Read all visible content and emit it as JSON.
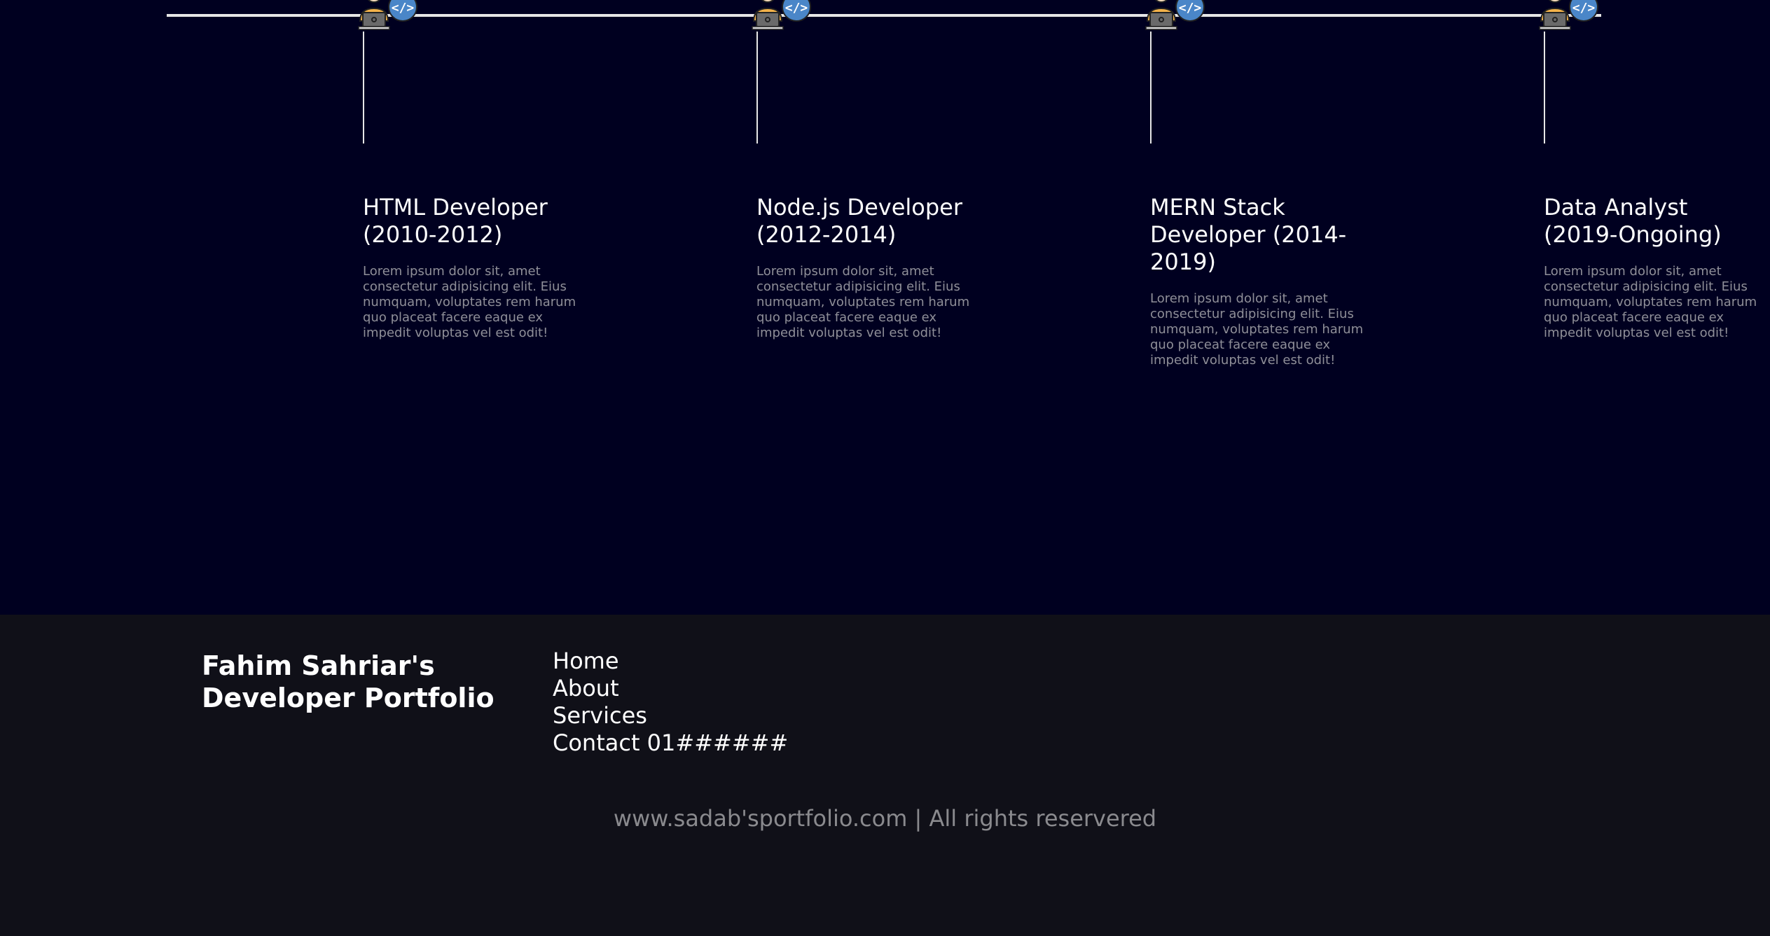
{
  "timeline": {
    "items": [
      {
        "title": "HTML Developer (2010-2012)",
        "description": "Lorem ipsum dolor sit, amet consectetur adipisicing elit. Eius numquam, voluptates rem harum quo placeat facere eaque ex impedit voluptas vel est odit!"
      },
      {
        "title": "Node.js Developer (2012-2014)",
        "description": "Lorem ipsum dolor sit, amet consectetur adipisicing elit. Eius numquam, voluptates rem harum quo placeat facere eaque ex impedit voluptas vel est odit!"
      },
      {
        "title": "MERN Stack Developer (2014-2019)",
        "description": "Lorem ipsum dolor sit, amet consectetur adipisicing elit. Eius numquam, voluptates rem harum quo placeat facere eaque ex impedit voluptas vel est odit!"
      },
      {
        "title": "Data Analyst (2019-Ongoing)",
        "description": "Lorem ipsum dolor sit, amet consectetur adipisicing elit. Eius numquam, voluptates rem harum quo placeat facere eaque ex impedit voluptas vel est odit!"
      }
    ],
    "icon": "developer-laptop-code-icon"
  },
  "footer": {
    "brand": "Fahim Sahriar's Developer Portfolio",
    "nav": [
      "Home",
      "About",
      "Services",
      "Contact 01######"
    ],
    "copyright": "www.sadab'sportfolio.com | All rights reservered"
  },
  "colors": {
    "timeline_bg": "#000020",
    "footer_bg": "#101018",
    "line": "#e6e6e6",
    "muted_text": "#8f8f98",
    "icon_accent": "#4a86c8"
  }
}
